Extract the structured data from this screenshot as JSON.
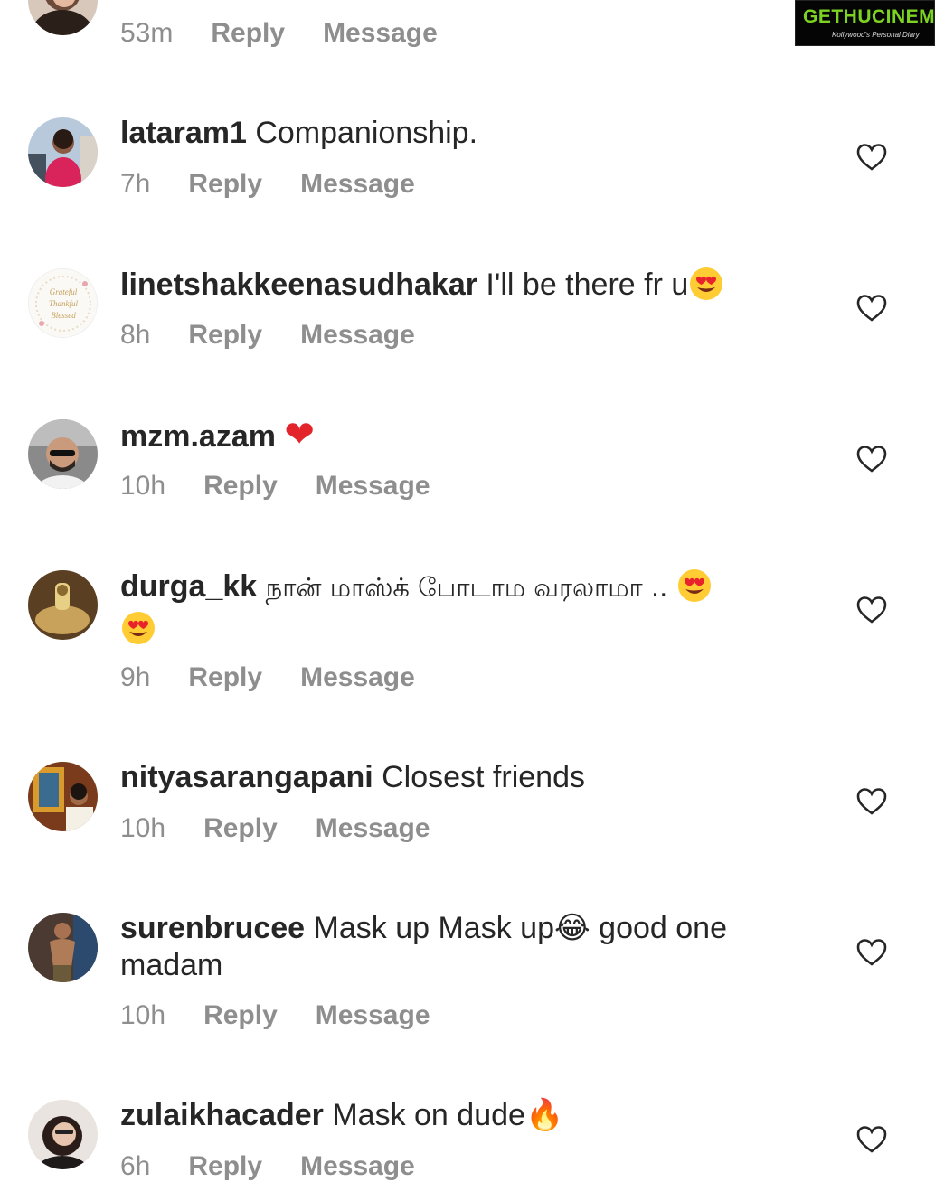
{
  "watermark": {
    "brand": "GETHUCINEMA",
    "tagline": "Kollywood's Personal Diary"
  },
  "actions": {
    "reply": "Reply",
    "message": "Message"
  },
  "comments": [
    {
      "username": "",
      "text": "",
      "time": "53m"
    },
    {
      "username": "lataram1",
      "text": "Companionship.",
      "time": "7h"
    },
    {
      "username": "linetshakkeenasudhakar",
      "text": "I'll be there fr u",
      "emoji": "heart-eyes-emoji",
      "time": "8h"
    },
    {
      "username": "mzm.azam",
      "text": "",
      "emoji": "red-heart-emoji",
      "emoji_char": "❤",
      "time": "10h"
    },
    {
      "username": "durga_kk",
      "text": "நான் மாஸ்க் போடாம வரலாமா ..",
      "emoji": "heart-eyes-emoji",
      "time": "9h"
    },
    {
      "username": "nityasarangapani",
      "text": "Closest friends",
      "time": "10h"
    },
    {
      "username": "surenbrucee",
      "text_before": "Mask up Mask up",
      "emoji_char": "😂",
      "text_after": " good one madam",
      "time": "10h"
    },
    {
      "username": "zulaikhacader",
      "text": "Mask on dude",
      "emoji_char": "🔥",
      "time": "6h"
    }
  ],
  "avatar_images": {
    "linetshakkeenasudhakar": [
      "Grateful",
      "Thankful",
      "Blessed"
    ]
  },
  "colors": {
    "text": "#262626",
    "meta": "#8e8e8e",
    "brand_green": "#7dd321"
  },
  "icons": {
    "like": "heart-outline-icon"
  }
}
